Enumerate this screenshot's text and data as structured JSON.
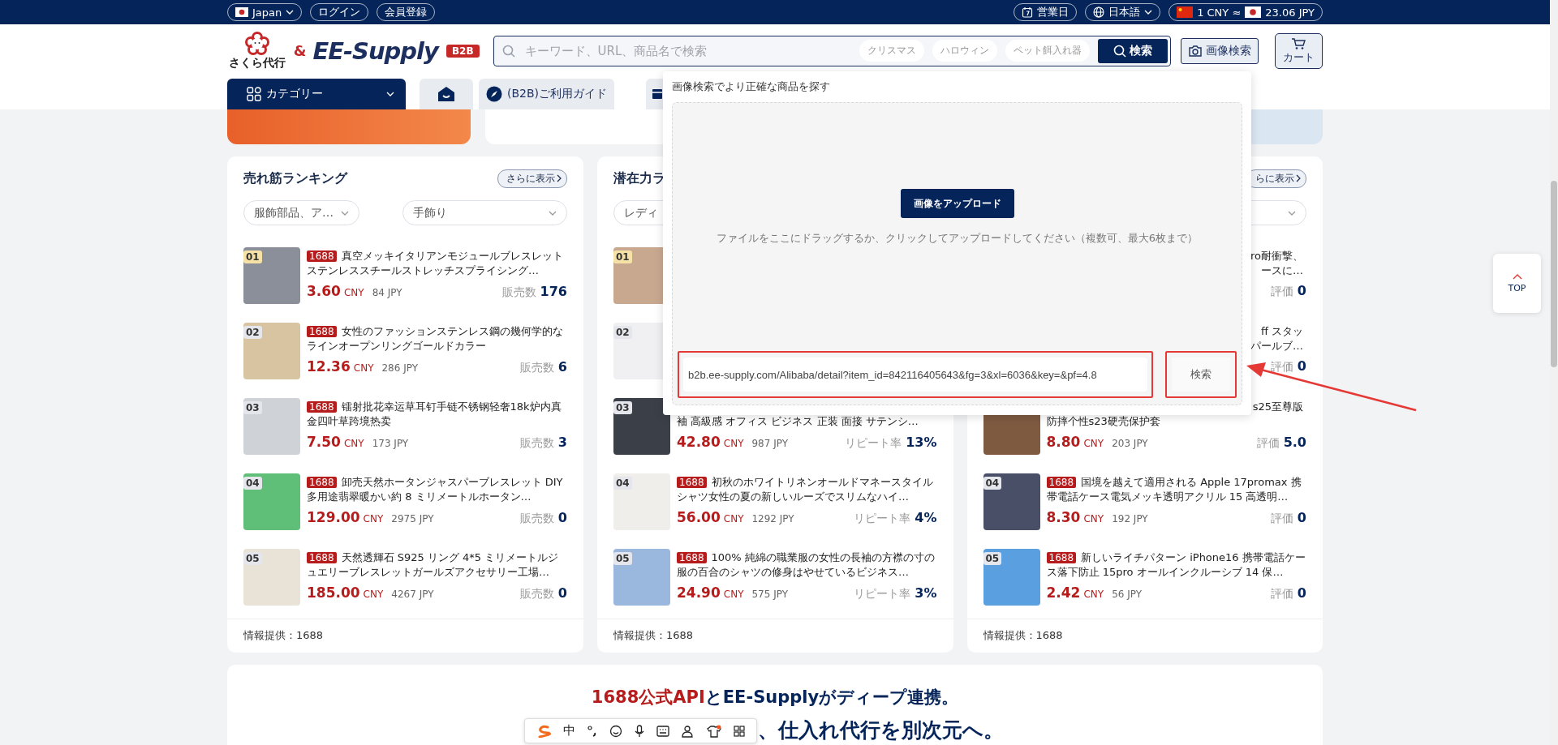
{
  "top_bar": {
    "region": "Japan",
    "links": [
      "ログイン",
      "会員登録"
    ],
    "business_days": "営業日",
    "language": "日本語",
    "rate_from": "1 CNY ≈",
    "rate_to": "23.06 JPY"
  },
  "header": {
    "logo_text": "さくら代行",
    "ampersand": "&",
    "brand": "EE-Supply",
    "badge": "B2B",
    "search": {
      "placeholder": "キーワード、URL、商品名で検索",
      "suggestions": [
        "クリスマス",
        "ハロウィン",
        "ペット餌入れ器"
      ],
      "button": "検索"
    },
    "image_search": "画像検索",
    "cart": "カート"
  },
  "nav": [
    {
      "kind": "category",
      "label": "カテゴリー"
    },
    {
      "kind": "home"
    },
    {
      "kind": "guide",
      "label": "(B2B)ご利用ガイド"
    },
    {
      "kind": "covered"
    }
  ],
  "rankings": [
    {
      "title": "売れ筋ランキング",
      "more": "さらに表示",
      "filters": [
        {
          "kind": "small",
          "label": "服飾部品、ア…"
        },
        {
          "kind": "wide",
          "label": "手飾り"
        }
      ],
      "source": "情報提供：1688",
      "items": [
        {
          "kind": "full",
          "rank": "01",
          "tag": "1688",
          "title": "真空メッキイタリアンモジュールブレスレットステンレススチールストレッチスプライシング…",
          "price": "3.60",
          "currency": "CNY",
          "jpy": "84 JPY",
          "metric_label": "販売数",
          "metric": "176"
        },
        {
          "kind": "full",
          "rank": "02",
          "tag": "1688",
          "title": "女性のファッションステンレス鋼の幾何学的なラインオープンリングゴールドカラー",
          "price": "12.36",
          "currency": "CNY",
          "jpy": "286 JPY",
          "metric_label": "販売数",
          "metric": "6"
        },
        {
          "kind": "full",
          "rank": "03",
          "tag": "1688",
          "title": "镭射批花幸运草耳钉手链不锈钢轻奢18k炉内真金四叶草跨境热卖",
          "price": "7.50",
          "currency": "CNY",
          "jpy": "173 JPY",
          "metric_label": "販売数",
          "metric": "3"
        },
        {
          "kind": "full",
          "rank": "04",
          "tag": "1688",
          "title": "卸売天然ホータンジャスパーブレスレット DIY 多用途翡翠暖かい約 8 ミリメートルホータン…",
          "price": "129.00",
          "currency": "CNY",
          "jpy": "2975 JPY",
          "metric_label": "販売数",
          "metric": "0"
        },
        {
          "kind": "full",
          "rank": "05",
          "tag": "1688",
          "title": "天然透輝石 S925 リング 4*5 ミリメートルジュエリーブレスレットガールズアクセサリー工場…",
          "price": "185.00",
          "currency": "CNY",
          "jpy": "4267 JPY",
          "metric_label": "販売数",
          "metric": "0"
        }
      ]
    },
    {
      "title": "潜在力ラ",
      "filters": [
        {
          "kind": "small",
          "label": "レディ"
        }
      ],
      "source": "情報提供：1688",
      "items": [
        {
          "kind": "hidden",
          "rank": "01"
        },
        {
          "kind": "hidden",
          "rank": "02"
        },
        {
          "kind": "lower",
          "rank": "03",
          "lines": [
            "袖 高級感 オフィス ビジネス 正装 面接 サテンシ…"
          ],
          "price": "42.80",
          "currency": "CNY",
          "jpy": "987 JPY",
          "metric_label": "リピート率",
          "metric": "13%"
        },
        {
          "kind": "full",
          "rank": "04",
          "tag": "1688",
          "title": "初秋のホワイトリネンオールドマネースタイルシャツ女性の夏の新しいルーズでスリムなハイ…",
          "price": "56.00",
          "currency": "CNY",
          "jpy": "1292 JPY",
          "metric_label": "リピート率",
          "metric": "4%"
        },
        {
          "kind": "full",
          "rank": "05",
          "tag": "1688",
          "title": "100% 純綿の職業服の女性の長袖の方襟の寸の服の百合のシャツの修身はやせているビジネス…",
          "price": "24.90",
          "currency": "CNY",
          "jpy": "575 JPY",
          "metric_label": "リピート率",
          "metric": "3%"
        }
      ]
    },
    {
      "more": "らに表示",
      "filters": [
        {
          "kind": "cut"
        }
      ],
      "source": "情報提供：1688",
      "items": [
        {
          "kind": "cut",
          "lines": [
            "ro耐衝撃、",
            "ースに…"
          ],
          "metric_label": "評価",
          "metric": "0"
        },
        {
          "kind": "cut",
          "lines": [
            "ff スタッ",
            "パールブ…"
          ],
          "metric_label": "評価",
          "metric": "0"
        },
        {
          "kind": "halfcut",
          "lines": [
            "s25至尊版",
            "防摔个性s23硬壳保护套"
          ],
          "price": "8.80",
          "currency": "CNY",
          "jpy": "203 JPY",
          "metric_label": "評価",
          "metric": "5.0"
        },
        {
          "kind": "full",
          "rank": "04",
          "tag": "1688",
          "title": "国境を越えて適用される Apple 17promax 携帯電話ケース電気メッキ透明アクリル 15 高透明…",
          "price": "8.30",
          "currency": "CNY",
          "jpy": "192 JPY",
          "metric_label": "評価",
          "metric": "0"
        },
        {
          "kind": "full",
          "rank": "05",
          "tag": "1688",
          "title": "新しいライチパターン iPhone16 携帯電話ケース落下防止 15pro オールインクルーシブ 14 保…",
          "price": "2.42",
          "currency": "CNY",
          "jpy": "56 JPY",
          "metric_label": "評価",
          "metric": "0"
        }
      ]
    }
  ],
  "image_search_popup": {
    "title": "画像検索でより正確な商品を探す",
    "upload_button": "画像をアップロード",
    "hint": "ファイルをここにドラッグするか、クリックしてアップロードしてください（複数可、最大6枚まで）",
    "url": "b2b.ee-supply.com/Alibaba/detail?item_id=842116405643&fg=3&xl=6036&key=&pf=4.8",
    "search_button": "検索"
  },
  "promo": {
    "headline": [
      {
        "kind": "accent",
        "text": "1688公式API"
      },
      {
        "kind": "plain",
        "text": "と"
      },
      {
        "kind": "plain",
        "text": "EE-Supply"
      },
      {
        "kind": "plain",
        "text": "がディープ連携。"
      }
    ],
    "subline": "、仕入れ代行を別次元へ。"
  },
  "top_button": "TOP",
  "ime_toolbar": {
    "mode": "中"
  }
}
